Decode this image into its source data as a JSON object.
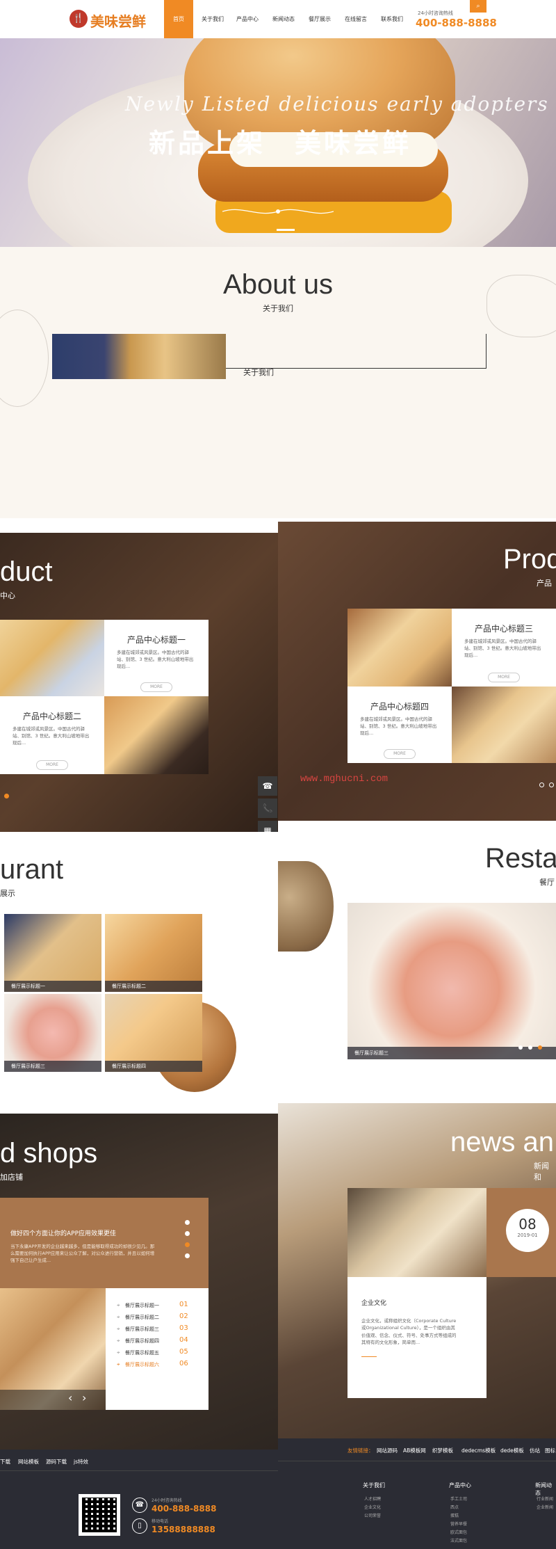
{
  "header": {
    "logo_mark": "🍴",
    "logo_text": "美味尝鲜",
    "nav": [
      {
        "label": "首页",
        "active": true
      },
      {
        "label": "关于我们"
      },
      {
        "label": "产品中心"
      },
      {
        "label": "新闻动态"
      },
      {
        "label": "餐厅展示"
      },
      {
        "label": "在线留言"
      },
      {
        "label": "联系我们"
      }
    ],
    "hotline_label": "24小时咨询热线",
    "hotline_number": "400-888-8888",
    "search_icon": "⌕"
  },
  "banner": {
    "script_text": "Newly Listed delicious early adopters",
    "title": "新品上架　美味尝鲜"
  },
  "about": {
    "title": "About us",
    "subtitle": "关于我们",
    "link": "关于我们"
  },
  "product": {
    "title_left": "duct",
    "subtitle_left": "中心",
    "title_right": "Prod",
    "subtitle_right": "产品",
    "cards": [
      {
        "title": "产品中心标题一",
        "desc": "多建在城郊或风景区。中国古代的驿站、别馆、3 世纪。意大利山坡地带出现后...",
        "more": "MORE"
      },
      {
        "title": "产品中心标题二",
        "desc": "多建在城郊或风景区。中国古代的驿站、别馆、3 世纪。意大利山坡地带出现后...",
        "more": "MORE"
      },
      {
        "title": "产品中心标题三",
        "desc": "多建在城郊或风景区。中国古代的驿站、别馆、3 世纪。意大利山坡地带出现后...",
        "more": "MORE"
      },
      {
        "title": "产品中心标题四",
        "desc": "多建在城郊或风景区。中国古代的驿站、别馆、3 世纪。意大利山坡地带出现后...",
        "more": "MORE"
      }
    ],
    "watermark": "www.mghucni.com"
  },
  "float_buttons": [
    "☎",
    "📞",
    "▦",
    "︿"
  ],
  "restaurant": {
    "title_left": "urant",
    "subtitle_left": "展示",
    "title_right": "Resta",
    "subtitle_right": "餐厅",
    "tiles": [
      {
        "label": "餐厅展示标题一"
      },
      {
        "label": "餐厅展示标题二"
      },
      {
        "label": "餐厅展示标题三"
      },
      {
        "label": "餐厅展示标题四"
      }
    ],
    "big_label": "餐厅展示标题三"
  },
  "shops": {
    "title": "d shops",
    "subtitle": "加店铺",
    "promo_title": "做好四个方面让你的APP应用效果更佳",
    "promo_desc": "当下永康APP开发的企业越来越多，但是能够取得成功的却很少见几。那么需要加何执行APP应用来让公众了解，对公众进行营销，并且以如何增强下自己让户生成...",
    "items": [
      {
        "label": "餐厅展示标题一",
        "num": "01"
      },
      {
        "label": "餐厅展示标题二",
        "num": "02"
      },
      {
        "label": "餐厅展示标题三",
        "num": "03"
      },
      {
        "label": "餐厅展示标题四",
        "num": "04"
      },
      {
        "label": "餐厅展示标题五",
        "num": "05"
      },
      {
        "label": "餐厅展示标题六",
        "num": "06"
      }
    ],
    "prev": "‹",
    "next": "›"
  },
  "news": {
    "title": "news an",
    "subtitle": "新闻和",
    "day": "08",
    "ym": "2019-01",
    "card_title": "企业文化",
    "card_desc": "企业文化，或称组织文化（Corporate Culture或Organizational Culture），是一个组织由其价值观、信念、仪式、符号、处事方式等组成的其特有的文化形象，简单而..."
  },
  "footer": {
    "left_links": [
      "下载",
      "网站模板",
      "源码下载",
      "js特效"
    ],
    "link_title": "友情链接：",
    "right_links": [
      "网站源码",
      "AB模板网",
      "织梦模板",
      "dedecms模板",
      "dede模板",
      "仿站",
      "图标"
    ],
    "hotline_label": "24小时咨询热线",
    "hotline": "400-888-8888",
    "mobile_label": "移动电话",
    "mobile": "13588888888",
    "col1_title": "关于我们",
    "col1_items": [
      "人才招聘",
      "企业文化",
      "公司荣誉"
    ],
    "col2_title": "产品中心",
    "col2_items": [
      "手工土司",
      "西点",
      "蛋糕",
      "营养早餐",
      "欧式面包",
      "法式面包"
    ],
    "col3_title": "新闻动态",
    "col3_items": [
      "行业新闻",
      "企业新闻"
    ]
  }
}
